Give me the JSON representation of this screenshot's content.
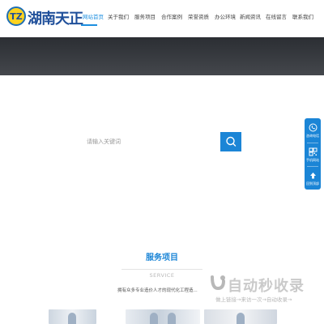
{
  "header": {
    "logo_text": "湖南天正",
    "logo_mark_text": "TZ",
    "nav": [
      {
        "label": "网站首页",
        "active": true
      },
      {
        "label": "关于我们",
        "active": false
      },
      {
        "label": "服务项目",
        "active": false
      },
      {
        "label": "合作案例",
        "active": false
      },
      {
        "label": "荣誉资质",
        "active": false
      },
      {
        "label": "办公环境",
        "active": false
      },
      {
        "label": "新闻资讯",
        "active": false
      },
      {
        "label": "在线留言",
        "active": false
      },
      {
        "label": "联系我们",
        "active": false
      }
    ]
  },
  "search": {
    "placeholder": "请输入关键词",
    "button_icon": "search-icon"
  },
  "float_bar": {
    "items": [
      {
        "label": "咨询电话",
        "icon": "phone-icon"
      },
      {
        "label": "手机网站",
        "icon": "qrcode-icon"
      },
      {
        "label": "回到顶部",
        "icon": "arrow-up-icon"
      }
    ]
  },
  "services": {
    "title": "服务项目",
    "subtitle": "SERVICE",
    "description": "拥有众多专业造价人才的现代化工程造..."
  },
  "watermark": {
    "brand": "自动秒收录",
    "slogan": "做上链接→来访一次→自动收录→"
  },
  "colors": {
    "accent": "#1b85d6",
    "banner": "#33363b",
    "logo_blue": "#1f4f9a",
    "logo_yellow": "#ffd21f"
  }
}
